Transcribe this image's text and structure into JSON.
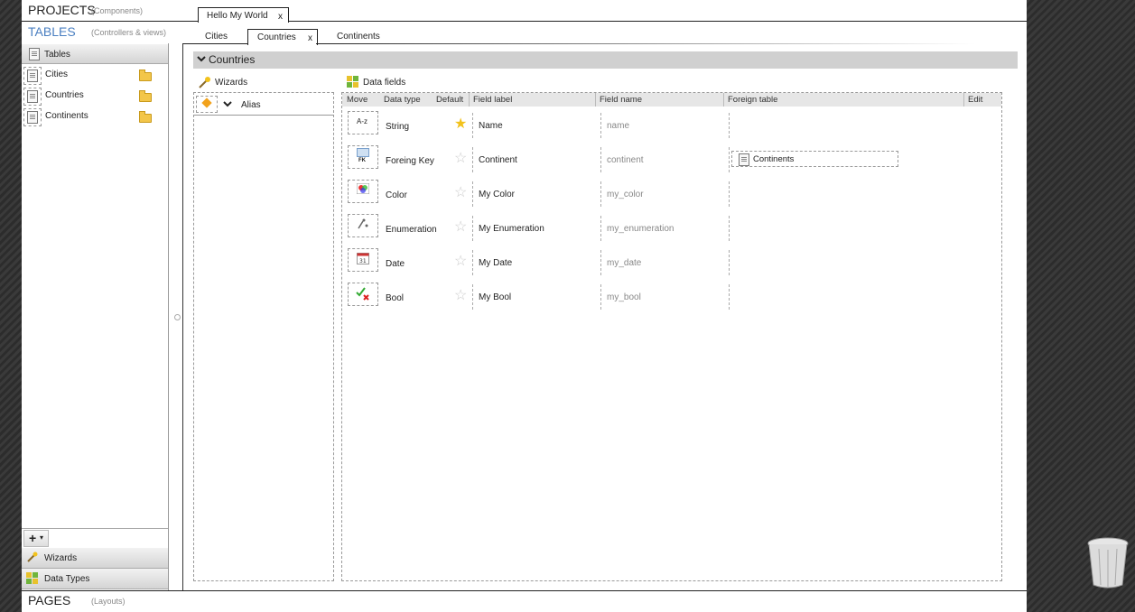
{
  "header": {
    "projects_title": "PROJECTS",
    "projects_sub": "(Components)",
    "tables_title": "TABLES",
    "tables_sub": "(Controllers & views)",
    "pages_title": "PAGES",
    "pages_sub": "(Layouts)"
  },
  "project_tab": {
    "label": "Hello My World",
    "close": "x"
  },
  "table_tabs": [
    {
      "label": "Cities"
    },
    {
      "label": "Countries",
      "close": "x"
    },
    {
      "label": "Continents"
    }
  ],
  "sidebar": {
    "section_label": "Tables",
    "items": [
      {
        "label": "Cities"
      },
      {
        "label": "Countries"
      },
      {
        "label": "Continents"
      }
    ],
    "add_label": "+",
    "add_caret": "▾",
    "bottom_sections": [
      {
        "label": "Wizards"
      },
      {
        "label": "Data Types"
      }
    ]
  },
  "panel": {
    "title": "Countries"
  },
  "wizards": {
    "title": "Wizards",
    "items": [
      {
        "label": "Alias"
      }
    ]
  },
  "datafields": {
    "title": "Data fields",
    "columns": {
      "move": "Move",
      "data_type": "Data type",
      "default": "Default",
      "field_label": "Field label",
      "field_name": "Field name",
      "foreign_table": "Foreign table",
      "edit": "Edit"
    },
    "rows": [
      {
        "icon_text": "A-z",
        "type": "String",
        "label": "Name",
        "name": "name",
        "foreign": "",
        "default": true
      },
      {
        "icon_text": "FK",
        "type": "Foreing Key",
        "label": "Continent",
        "name": "continent",
        "foreign": "Continents",
        "default": false
      },
      {
        "icon_text": "",
        "type": "Color",
        "label": "My Color",
        "name": "my_color",
        "foreign": "",
        "default": false
      },
      {
        "icon_text": "",
        "type": "Enumeration",
        "label": "My Enumeration",
        "name": "my_enumeration",
        "foreign": "",
        "default": false
      },
      {
        "icon_text": "",
        "type": "Date",
        "label": "My Date",
        "name": "my_date",
        "foreign": "",
        "default": false
      },
      {
        "icon_text": "",
        "type": "Bool",
        "label": "My Bool",
        "name": "my_bool",
        "foreign": "",
        "default": false
      }
    ]
  },
  "colors": {
    "accent_blue": "#4a7fc1",
    "star_on": "#f2c21b",
    "star_off": "#cccccc"
  }
}
